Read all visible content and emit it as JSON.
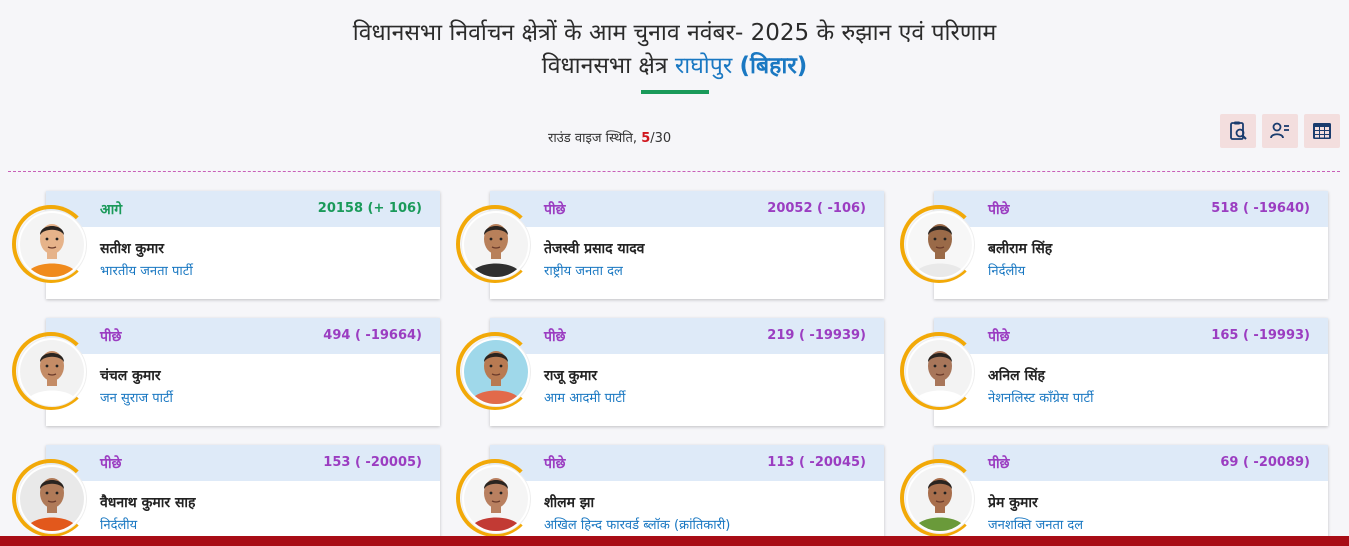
{
  "header": {
    "title_line1": "विधानसभा निर्वाचन क्षेत्रों के आम चुनाव नवंबर- 2025 के रुझान एवं परिणाम",
    "title_line2_prefix": "विधानसभा क्षेत्र",
    "constituency": "राघोपुर",
    "state": "(बिहार)"
  },
  "round": {
    "label": "राउंड वाइज स्थिति,",
    "current": "5",
    "total": "/30"
  },
  "view_icons": [
    "clipboard-search-icon",
    "candidate-list-icon",
    "table-grid-icon"
  ],
  "colors": {
    "lead": "#1a9a5a",
    "trail": "#9b3dc1",
    "party": "#1a78c2",
    "ring": "#f2a908",
    "card_head": "#deeaf8"
  },
  "candidates": [
    {
      "status": "आगे",
      "votes": "20158 (+ 106)",
      "name": "सतीश कुमार",
      "party": "भारतीय जनता पार्टी",
      "leading": true,
      "skin": "#e6b38a",
      "shirt": "#f08a1c",
      "bg": "#f4f4f4"
    },
    {
      "status": "पीछे",
      "votes": "20052 ( -106)",
      "name": "तेजस्वी प्रसाद यादव",
      "party": "राष्ट्रीय जनता दल",
      "leading": false,
      "skin": "#b8805a",
      "shirt": "#2f2f2f",
      "bg": "#f4f4f4"
    },
    {
      "status": "पीछे",
      "votes": "518 ( -19640)",
      "name": "बलीराम सिंह",
      "party": "निर्दलीय",
      "leading": false,
      "skin": "#9a6a48",
      "shirt": "#e9e9e9",
      "bg": "#f7f7f7"
    },
    {
      "status": "पीछे",
      "votes": "494 ( -19664)",
      "name": "चंचल कुमार",
      "party": "जन सुराज पार्टी",
      "leading": false,
      "skin": "#c48c66",
      "shirt": "#ffffff",
      "bg": "#f2f2f2"
    },
    {
      "status": "पीछे",
      "votes": "219 ( -19939)",
      "name": "राजू कुमार",
      "party": "आम आदमी पार्टी",
      "leading": false,
      "skin": "#b87a52",
      "shirt": "#e26a4a",
      "bg": "#9fd8ea"
    },
    {
      "status": "पीछे",
      "votes": "165 ( -19993)",
      "name": "अनिल सिंह",
      "party": "नेशनलिस्ट कॉंग्रेस पार्टी",
      "leading": false,
      "skin": "#a8765a",
      "shirt": "#ffffff",
      "bg": "#f3f3f3"
    },
    {
      "status": "पीछे",
      "votes": "153 ( -20005)",
      "name": "वैधनाथ कुमार साह",
      "party": "निर्दलीय",
      "leading": false,
      "skin": "#b07a58",
      "shirt": "#e2581c",
      "bg": "#e9e9e9"
    },
    {
      "status": "पीछे",
      "votes": "113 ( -20045)",
      "name": "शीलम झा",
      "party": "अखिल हिन्द फारवर्ड ब्लॉक (क्रांतिकारी)",
      "leading": false,
      "skin": "#b98060",
      "shirt": "#c23a34",
      "bg": "#f5f5f5"
    },
    {
      "status": "पीछे",
      "votes": "69 ( -20089)",
      "name": "प्रेम कुमार",
      "party": "जनशक्ति जनता दल",
      "leading": false,
      "skin": "#a86e4c",
      "shirt": "#6a9a3a",
      "bg": "#f4f4f4"
    }
  ]
}
